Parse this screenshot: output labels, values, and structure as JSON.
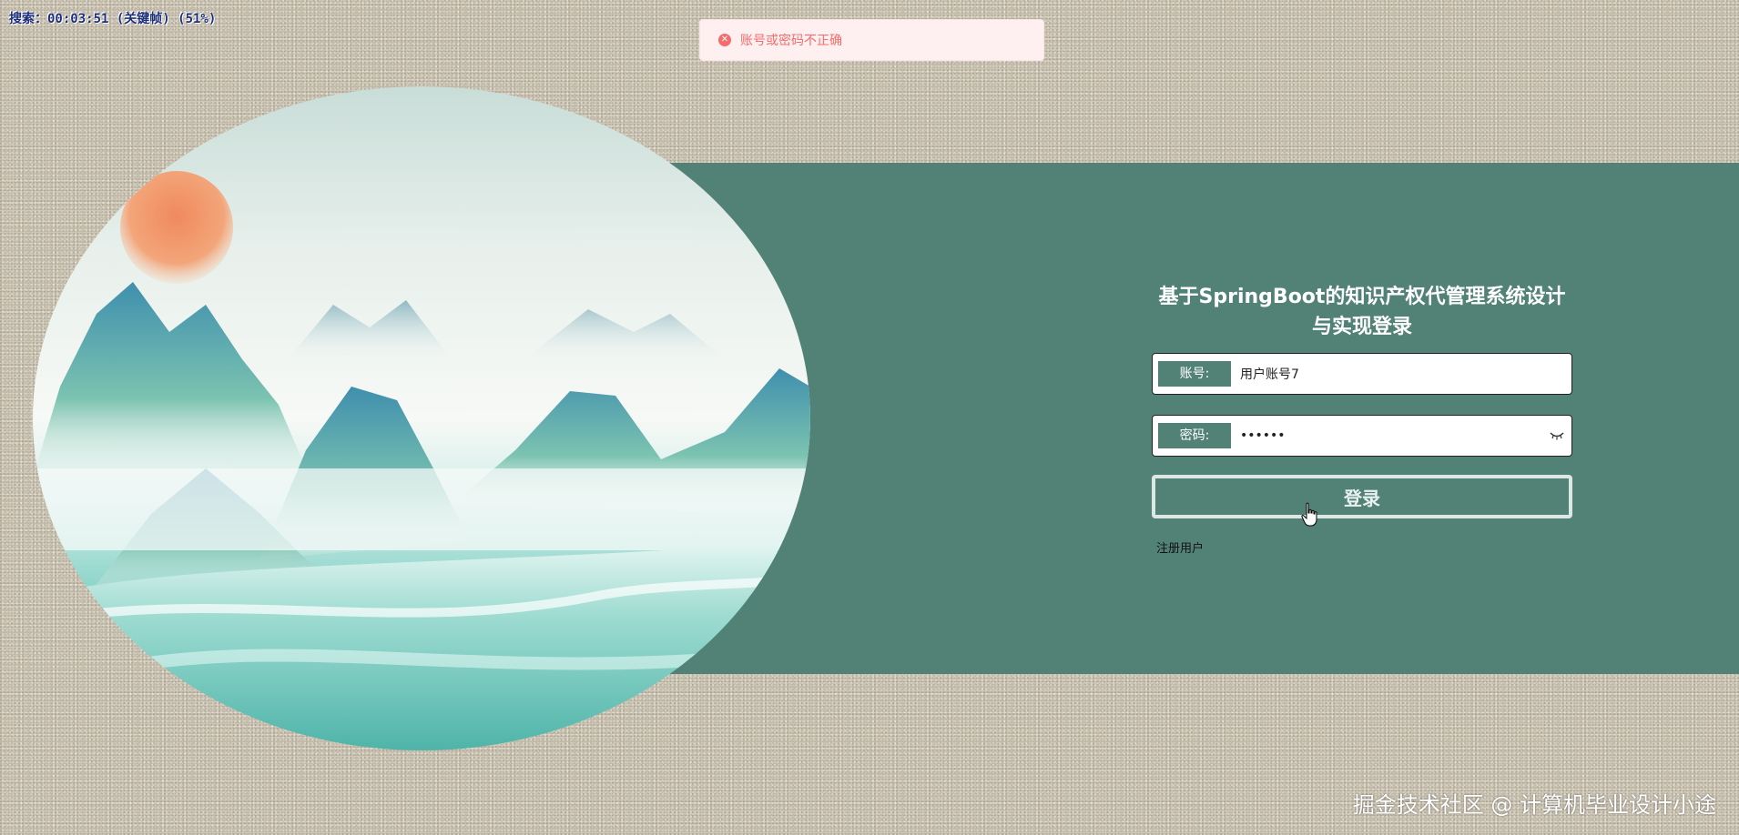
{
  "overlay": {
    "recording_text": "搜索：00:03:51 (关键帧) (51%)"
  },
  "toast": {
    "icon": "error-circle-icon",
    "message": "账号或密码不正确",
    "color": "#f56c6c"
  },
  "login": {
    "title": "基于SpringBoot的知识产权代管理系统设计与实现登录",
    "account": {
      "label": "账号:",
      "value": "用户账号7"
    },
    "password": {
      "label": "密码:",
      "masked_value": "••••••",
      "icon": "eye-closed-icon"
    },
    "submit_label": "登录",
    "register_label": "注册用户"
  },
  "colors": {
    "accent": "#528276",
    "panel_title": "#ffffff",
    "error": "#f56c6c"
  },
  "watermark": {
    "text": "掘金技术社区 @ 计算机毕业设计小途"
  }
}
